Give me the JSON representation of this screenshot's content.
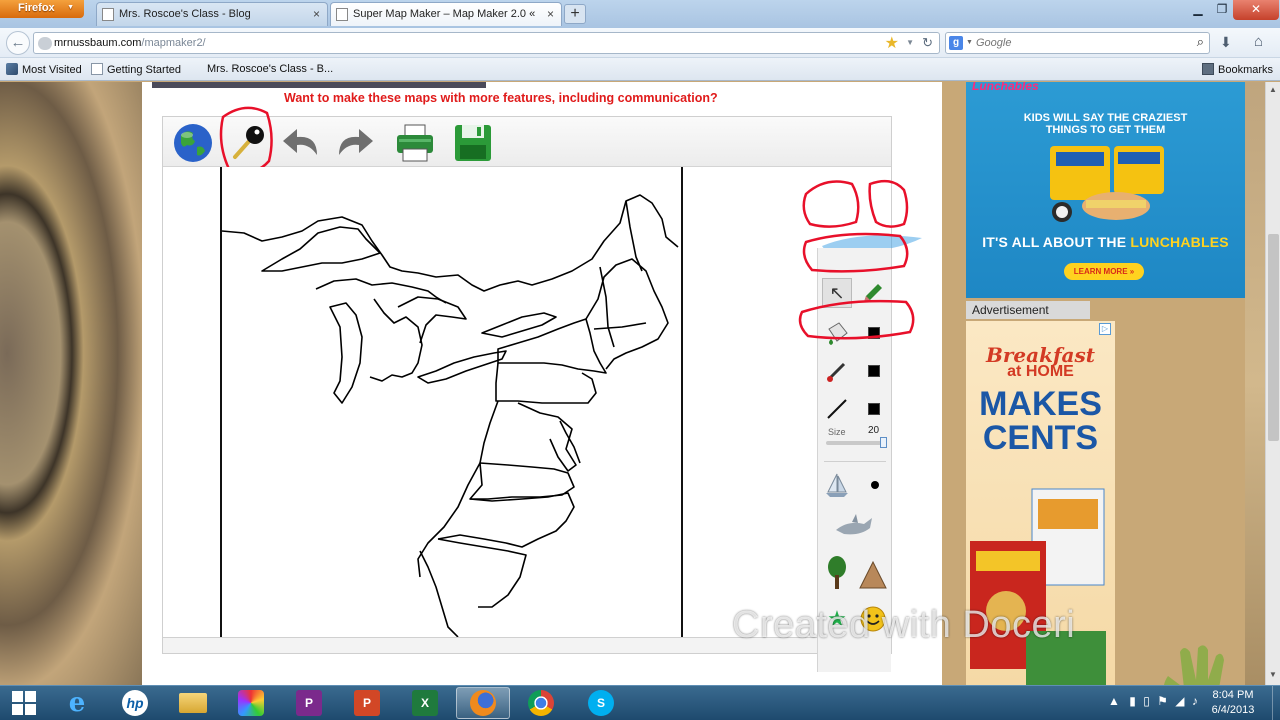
{
  "browser": {
    "menu_button": "Firefox",
    "tabs": [
      {
        "label": "Mrs. Roscoe's Class - Blog",
        "active": false
      },
      {
        "label": "Super Map Maker – Map Maker 2.0 «",
        "active": true
      }
    ],
    "url_host": "mrnussbaum.com",
    "url_path": "/mapmaker2/",
    "search_placeholder": "Google",
    "bookmarks": [
      "Most Visited",
      "Getting Started",
      "Mrs. Roscoe's Class - B...",
      "Bookmarks"
    ]
  },
  "page": {
    "promo_text": "Want to make these maps with more features, including communication?",
    "toolbar_tools": [
      "globe-icon",
      "key-icon",
      "undo-icon",
      "redo-icon",
      "printer-icon",
      "save-icon"
    ],
    "tools": {
      "size_label": "Size",
      "size_value": "20",
      "stamps": [
        "sailboat-icon",
        "dot-icon",
        "shark-icon",
        "tree-icon",
        "mountain-icon",
        "star-icon",
        "smiley-icon"
      ]
    },
    "watermark": "Created with Doceri"
  },
  "ads": {
    "ad1": {
      "brand": "Lunchables",
      "headline": "KIDS WILL SAY THE CRAZIEST THINGS TO GET THEM",
      "headline2_prefix": "IT'S ALL ABOUT THE ",
      "headline2_highlight": "LUNCHABLES",
      "cta": "LEARN MORE »"
    },
    "label": "Advertisement",
    "ad2": {
      "line1": "Breakfast",
      "line2": "at HOME",
      "line3a": "MAKES",
      "line3b": "CENTS"
    }
  },
  "taskbar": {
    "apps": [
      "internet-explorer",
      "hp",
      "file-explorer",
      "paint",
      "publisher",
      "powerpoint",
      "excel",
      "firefox",
      "chrome",
      "skype"
    ],
    "time": "8:04 PM",
    "date": "6/4/2013"
  },
  "colors": {
    "annotation_red": "#e8102a",
    "promo_red": "#e01b1b",
    "ad_blue": "#2c9bd4"
  }
}
